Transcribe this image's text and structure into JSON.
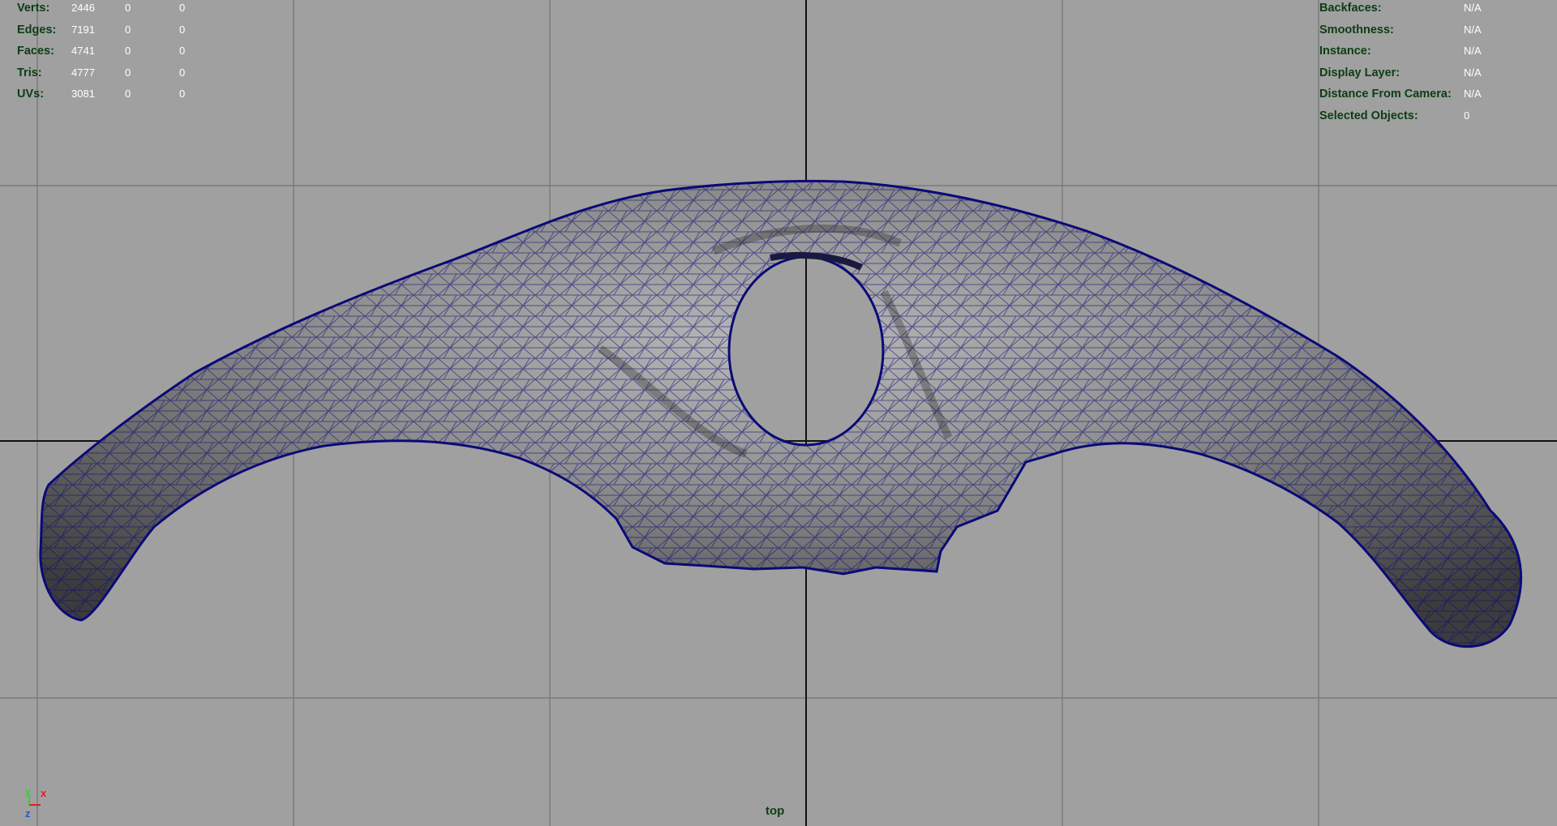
{
  "viewport": {
    "camera_name": "top",
    "background_color": "#a0a0a0",
    "grid_color": "#7a7a7a",
    "axis_line_color": "#111111",
    "wire_color": "#0a0a78"
  },
  "hud_left": {
    "rows": [
      {
        "label": "Verts:",
        "total": "2446",
        "selected": "0",
        "selected_component": "0"
      },
      {
        "label": "Edges:",
        "total": "7191",
        "selected": "0",
        "selected_component": "0"
      },
      {
        "label": "Faces:",
        "total": "4741",
        "selected": "0",
        "selected_component": "0"
      },
      {
        "label": "Tris:",
        "total": "4777",
        "selected": "0",
        "selected_component": "0"
      },
      {
        "label": "UVs:",
        "total": "3081",
        "selected": "0",
        "selected_component": "0"
      }
    ]
  },
  "hud_right": {
    "rows": [
      {
        "label": "Backfaces:",
        "value": "N/A"
      },
      {
        "label": "Smoothness:",
        "value": "N/A"
      },
      {
        "label": "Instance:",
        "value": "N/A"
      },
      {
        "label": "Display Layer:",
        "value": "N/A"
      },
      {
        "label": "Distance From Camera:",
        "value": "N/A"
      },
      {
        "label": "Selected Objects:",
        "value": "0"
      }
    ]
  },
  "axis_gizmo": {
    "axes": [
      {
        "name": "y",
        "color": "#2fd52f"
      },
      {
        "name": "x",
        "color": "#e02020"
      },
      {
        "name": "z",
        "color": "#2a4fd8"
      }
    ]
  }
}
